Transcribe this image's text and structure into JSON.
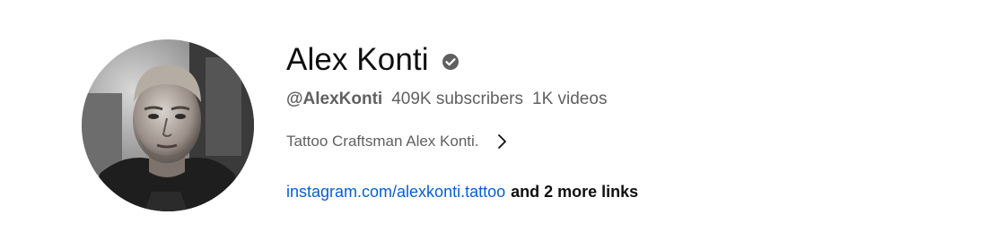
{
  "channel": {
    "name": "Alex Konti",
    "verified_icon": "verified-check-icon",
    "handle": "@AlexKonti",
    "subscribers": "409K subscribers",
    "videos": "1K videos",
    "description": "Tattoo Craftsman Alex Konti.",
    "description_icon": "chevron-right-icon",
    "primary_link": "instagram.com/alexkonti.tattoo",
    "more_links": "and 2 more links",
    "avatar_alt": "avatar"
  },
  "colors": {
    "name_text": "#0f0f0f",
    "secondary_text": "#606060",
    "link": "#065fd4",
    "background": "#ffffff"
  }
}
